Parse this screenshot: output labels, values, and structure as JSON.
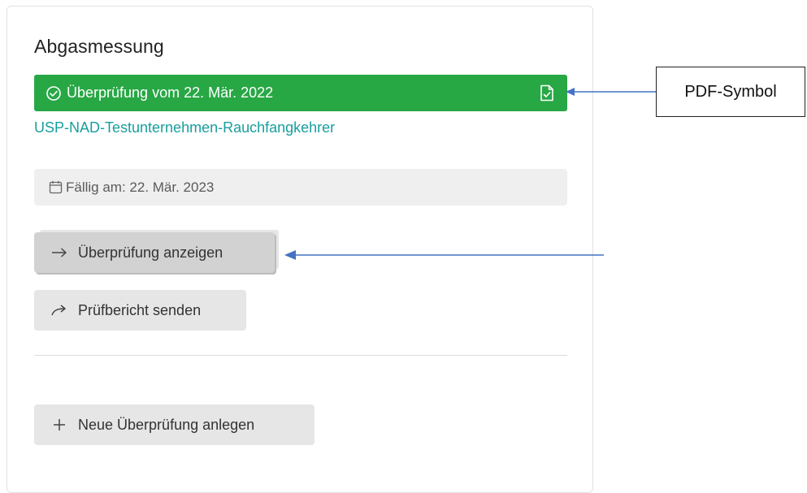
{
  "card": {
    "title": "Abgasmessung",
    "inspection": {
      "label": "Überprüfung vom 22. Mär. 2022",
      "status_color": "#28a745",
      "status_icon": "check-circle-icon",
      "pdf_icon": "pdf-document-icon"
    },
    "company_link": "USP-NAD-Testunternehmen-Rauchfangkehrer",
    "due": {
      "icon": "calendar-icon",
      "label": "Fällig am: 22. Mär. 2023"
    },
    "buttons": {
      "show_inspection": {
        "label": "Überprüfung anzeigen",
        "icon": "arrow-right-icon"
      },
      "send_report": {
        "label": "Prüfbericht senden",
        "icon": "share-arrow-icon"
      },
      "new_inspection": {
        "label": "Neue Überprüfung anlegen",
        "icon": "plus-icon"
      }
    }
  },
  "annotation": {
    "callout_label": "PDF-Symbol",
    "arrow_color": "#4472c4"
  }
}
